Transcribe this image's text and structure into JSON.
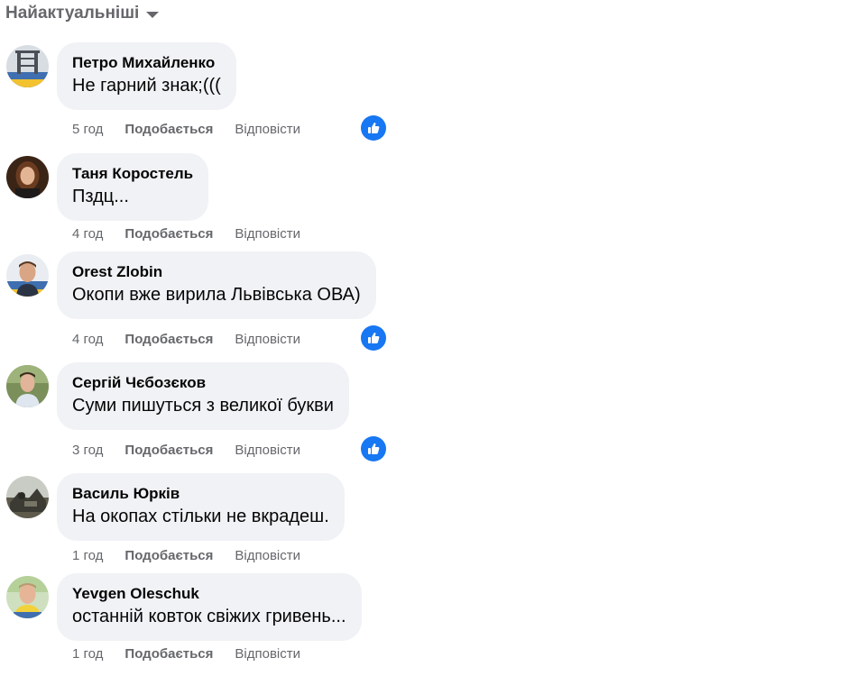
{
  "sort": {
    "label": "Найактуальніші",
    "icon": "caret-down-icon"
  },
  "colors": {
    "bubble": "#f0f2f5",
    "secondary_text": "#65676b",
    "reaction_blue": "#1877f2"
  },
  "comments": [
    {
      "author": "Петро Михайленко",
      "text": "Не гарний знак;(((",
      "time": "5 год",
      "like_label": "Подобається",
      "reply_label": "Відповісти",
      "reaction": "like-icon"
    },
    {
      "author": "Таня Коростель",
      "text": "Пздц...",
      "time": "4 год",
      "like_label": "Подобається",
      "reply_label": "Відповісти"
    },
    {
      "author": "Orest Zlobin",
      "text": "Окопи вже вирила Львівська ОВА)",
      "time": "4 год",
      "like_label": "Подобається",
      "reply_label": "Відповісти",
      "reaction": "like-icon"
    },
    {
      "author": "Сергій Чєбозєков",
      "text": "Суми пишуться з великої букви",
      "time": "3 год",
      "like_label": "Подобається",
      "reply_label": "Відповісти",
      "reaction": "like-icon"
    },
    {
      "author": "Василь Юрків",
      "text": "На окопах стільки не вкрадеш.",
      "time": "1 год",
      "like_label": "Подобається",
      "reply_label": "Відповісти"
    },
    {
      "author": "Yevgen Oleschuk",
      "text": "останній ковток свіжих гривень...",
      "time": "1 год",
      "like_label": "Подобається",
      "reply_label": "Відповісти"
    }
  ]
}
